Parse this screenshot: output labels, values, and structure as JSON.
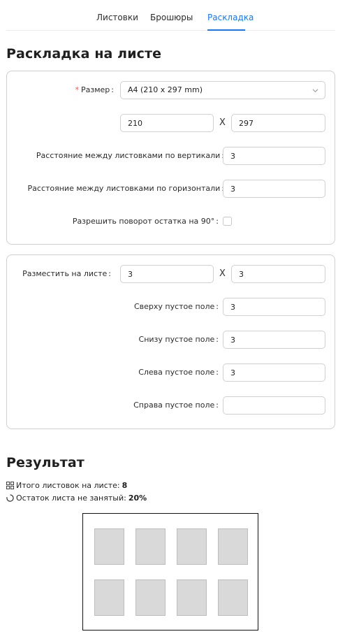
{
  "tabs": [
    {
      "label": "Листовки"
    },
    {
      "label": "Брошюры"
    },
    {
      "label": "Раскладка"
    }
  ],
  "layout_section": {
    "title": "Раскладка на листе",
    "size": {
      "label": "Размер",
      "value": "A4 (210 x 297 mm)"
    },
    "width": {
      "value": "210"
    },
    "height": {
      "value": "297"
    },
    "separator": "X",
    "vertical_gap": {
      "label": "Расстояние между листовками по вертикали",
      "value": "3"
    },
    "horizontal_gap": {
      "label": "Расстояние между листовками по горизонтали",
      "value": "3"
    },
    "rotate": {
      "label": "Разрешить поворот остатка на 90°",
      "checked": false
    }
  },
  "placement_section": {
    "place": {
      "label": "Разместить на листе",
      "cols": "3",
      "rows": "3"
    },
    "top_margin": {
      "label": "Сверху пустое поле",
      "value": "3"
    },
    "bottom_margin": {
      "label": "Снизу пустое поле",
      "value": "3"
    },
    "left_margin": {
      "label": "Слева пустое поле",
      "value": "3"
    },
    "right_margin": {
      "label": "Справа пустое поле",
      "value": ""
    }
  },
  "result": {
    "title": "Результат",
    "total_label": "Итого листовок на листе:",
    "total_value": "8",
    "waste_label": "Остаток листа не занятый:",
    "waste_value": "20%",
    "preview_grid": {
      "columns": 4,
      "rows": 2,
      "count": 8
    }
  },
  "colors": {
    "accent": "#1677ff",
    "required": "#ff4d4f",
    "leaf": "#d9d9d9"
  }
}
